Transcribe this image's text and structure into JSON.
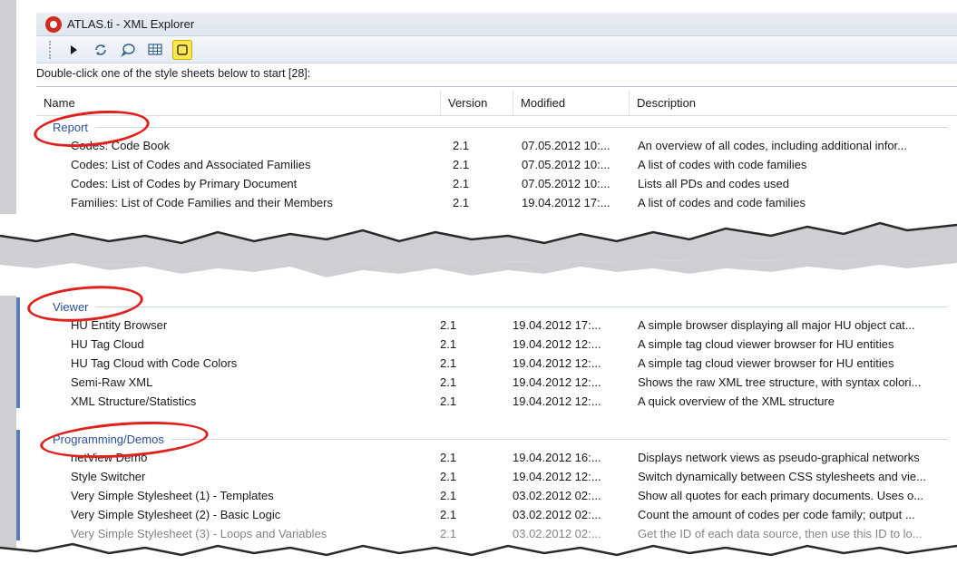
{
  "window": {
    "title": "ATLAS.ti - XML Explorer"
  },
  "toolbar": {
    "buttons": [
      "play-icon",
      "refresh-icon",
      "comment-icon",
      "table-icon",
      "highlight-icon"
    ]
  },
  "hint": "Double-click one of the style sheets below to start [28]:",
  "columns": {
    "name": "Name",
    "version": "Version",
    "modified": "Modified",
    "description": "Description"
  },
  "groups": [
    {
      "label": "Report",
      "rows": [
        {
          "name": "Codes: Code Book",
          "version": "2.1",
          "modified": "07.05.2012 10:...",
          "description": "An overview of all codes, including additional infor..."
        },
        {
          "name": "Codes: List of Codes and Associated Families",
          "version": "2.1",
          "modified": "07.05.2012 10:...",
          "description": "A list of codes with code families"
        },
        {
          "name": "Codes: List of Codes by Primary Document",
          "version": "2.1",
          "modified": "07.05.2012 10:...",
          "description": "Lists all PDs and codes used"
        },
        {
          "name": "Families: List of Code Families and their Members",
          "version": "2.1",
          "modified": "19.04.2012 17:...",
          "description": "A list of codes and code families"
        }
      ]
    },
    {
      "label": "Viewer",
      "rows": [
        {
          "name": "HU Entity Browser",
          "version": "2.1",
          "modified": "19.04.2012 17:...",
          "description": "A simple browser displaying all major HU object cat..."
        },
        {
          "name": "HU Tag Cloud",
          "version": "2.1",
          "modified": "19.04.2012 12:...",
          "description": "A simple tag cloud viewer browser for HU entities"
        },
        {
          "name": "HU Tag Cloud with Code Colors",
          "version": "2.1",
          "modified": "19.04.2012 12:...",
          "description": "A simple tag cloud viewer browser for HU entities"
        },
        {
          "name": "Semi-Raw XML",
          "version": "2.1",
          "modified": "19.04.2012 12:...",
          "description": "Shows the raw XML tree structure, with syntax colori..."
        },
        {
          "name": "XML Structure/Statistics",
          "version": "2.1",
          "modified": "19.04.2012 12:...",
          "description": "A quick overview of the XML structure"
        }
      ]
    },
    {
      "label": "Programming/Demos",
      "rows": [
        {
          "name": "netView Demo",
          "version": "2.1",
          "modified": "19.04.2012 16:...",
          "description": "Displays network views as pseudo-graphical networks"
        },
        {
          "name": "Style Switcher",
          "version": "2.1",
          "modified": "19.04.2012 12:...",
          "description": "Switch dynamically between CSS stylesheets and vie..."
        },
        {
          "name": "Very Simple Stylesheet (1) - Templates",
          "version": "2.1",
          "modified": "03.02.2012 02:...",
          "description": "Show all quotes for each primary documents. Uses o..."
        },
        {
          "name": "Very Simple Stylesheet (2) - Basic Logic",
          "version": "2.1",
          "modified": "03.02.2012 02:...",
          "description": "Count the amount of codes per code family; output ..."
        },
        {
          "name": "Very Simple Stylesheet (3) - Loops and Variables",
          "version": "2.1",
          "modified": "03.02.2012 02:...",
          "description": "Get the ID of each data source, then use this ID to lo..."
        }
      ]
    }
  ],
  "colors": {
    "group_label": "#2a4f9c",
    "annotation_circle": "#e0201b",
    "highlight_button": "#ffe74d"
  }
}
